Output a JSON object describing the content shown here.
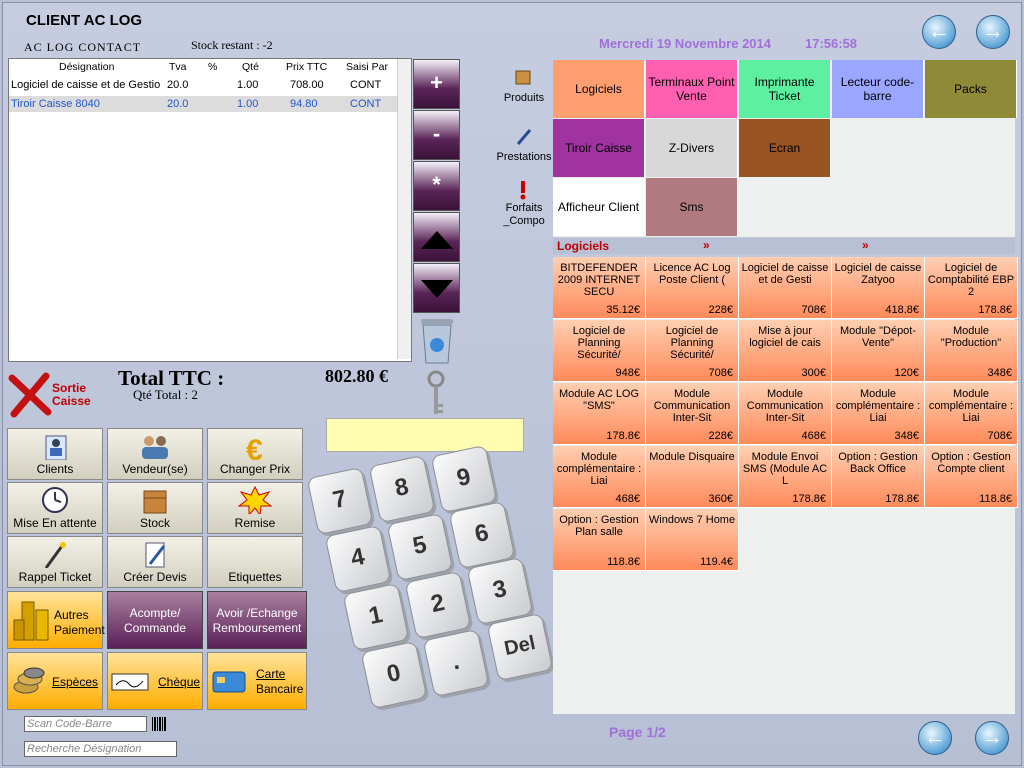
{
  "client": {
    "title": "CLIENT AC LOG",
    "contact": "AC LOG CONTACT",
    "stock": "Stock restant : -2"
  },
  "datetime": {
    "date": "Mercredi 19 Novembre 2014",
    "time": "17:56:58"
  },
  "table": {
    "headers": [
      "Désignation",
      "Tva",
      "%",
      "Qté",
      "Prix TTC",
      "Saisi Par"
    ],
    "rows": [
      {
        "designation": "Logiciel de caisse et de Gestion",
        "tva": "20.0",
        "pct": "",
        "qte": "1.00",
        "prix": "708.00",
        "saisi": "CONT"
      },
      {
        "designation": "Tiroir Caisse 8040",
        "tva": "20.0",
        "pct": "",
        "qte": "1.00",
        "prix": "94.80",
        "saisi": "CONT"
      }
    ]
  },
  "sidekeys": {
    "plus": "+",
    "minus": "-",
    "star": "*"
  },
  "totals": {
    "label": "Total TTC :",
    "value": "802.80 €",
    "qte": "Qté Total : 2"
  },
  "sortie": {
    "line1": "Sortie",
    "line2": "Caisse"
  },
  "functions": {
    "clients": "Clients",
    "vendeur": "Vendeur(se)",
    "changer_prix": "Changer Prix",
    "attente": "Mise En attente",
    "stock": "Stock",
    "remise": "Remise",
    "rappel": "Rappel Ticket",
    "devis": "Créer Devis",
    "etiquettes": "Etiquettes",
    "autres1": "Autres",
    "autres2": "Paiement",
    "acompte1": "Acompte/",
    "acompte2": "Commande",
    "avoir1": "Avoir /Echange",
    "avoir2": "Remboursement",
    "especes": "Espèces",
    "cheque": "Chèque",
    "carte1": "Carte",
    "carte2": "Bancaire"
  },
  "inputs": {
    "scan": "Scan Code-Barre",
    "recherche": "Recherche Désignation"
  },
  "numpad": [
    "7",
    "8",
    "9",
    "4",
    "5",
    "6",
    "1",
    "2",
    "3",
    "0",
    ".",
    "Del"
  ],
  "nav": {
    "produits": "Produits",
    "prestations": "Prestations",
    "forfaits1": "Forfaits",
    "forfaits2": "_Compo"
  },
  "categories": [
    {
      "label": "Logiciels",
      "color": "#ff9e6e"
    },
    {
      "label": "Terminaux Point Vente",
      "color": "#ff5fb0"
    },
    {
      "label": "Imprimante Ticket",
      "color": "#5cf0a0"
    },
    {
      "label": "Lecteur code-barre",
      "color": "#9aa6ff"
    },
    {
      "label": "Packs",
      "color": "#8e8a38"
    },
    {
      "label": "Tiroir Caisse",
      "color": "#a033a0"
    },
    {
      "label": "Z-Divers",
      "color": "#d8d8d8"
    },
    {
      "label": "Ecran",
      "color": "#9a5424"
    },
    {
      "label": "Afficheur Client",
      "color": "#ffffff"
    },
    {
      "label": "Sms",
      "color": "#b07a80"
    }
  ],
  "breadcrumb": {
    "current": "Logiciels",
    "sep1": "»",
    "sep2": "»"
  },
  "products": [
    {
      "name": "BITDEFENDER 2009 INTERNET SECU",
      "price": "35.12€"
    },
    {
      "name": "Licence AC Log Poste Client (",
      "price": "228€"
    },
    {
      "name": "Logiciel de caisse et de Gesti",
      "price": "708€"
    },
    {
      "name": "Logiciel de caisse Zatyoo",
      "price": "418.8€"
    },
    {
      "name": "Logiciel de Comptabilité EBP 2",
      "price": "178.8€"
    },
    {
      "name": "Logiciel de Planning Sécurité/",
      "price": "948€"
    },
    {
      "name": "Logiciel de Planning Sécurité/",
      "price": "708€"
    },
    {
      "name": "Mise à jour logiciel de cais",
      "price": "300€"
    },
    {
      "name": "Module \"Dépot-Vente\"",
      "price": "120€"
    },
    {
      "name": "Module \"Production\"",
      "price": "348€"
    },
    {
      "name": "Module AC LOG \"SMS\"",
      "price": "178.8€"
    },
    {
      "name": "Module Communication Inter-Sit",
      "price": "228€"
    },
    {
      "name": "Module Communication Inter-Sit",
      "price": "468€"
    },
    {
      "name": "Module complémentaire : Liai",
      "price": "348€"
    },
    {
      "name": "Module complémentaire : Liai",
      "price": "708€"
    },
    {
      "name": "Module complémentaire : Liai",
      "price": "468€"
    },
    {
      "name": "Module Disquaire",
      "price": "360€"
    },
    {
      "name": "Module Envoi SMS (Module AC L",
      "price": "178.8€"
    },
    {
      "name": "Option : Gestion Back Office",
      "price": "178.8€"
    },
    {
      "name": "Option : Gestion Compte client",
      "price": "118.8€"
    },
    {
      "name": "Option : Gestion Plan salle",
      "price": "118.8€"
    },
    {
      "name": "Windows 7 Home",
      "price": "119.4€"
    }
  ],
  "page": "Page 1/2",
  "arrows": {
    "left": "←",
    "right": "→"
  }
}
